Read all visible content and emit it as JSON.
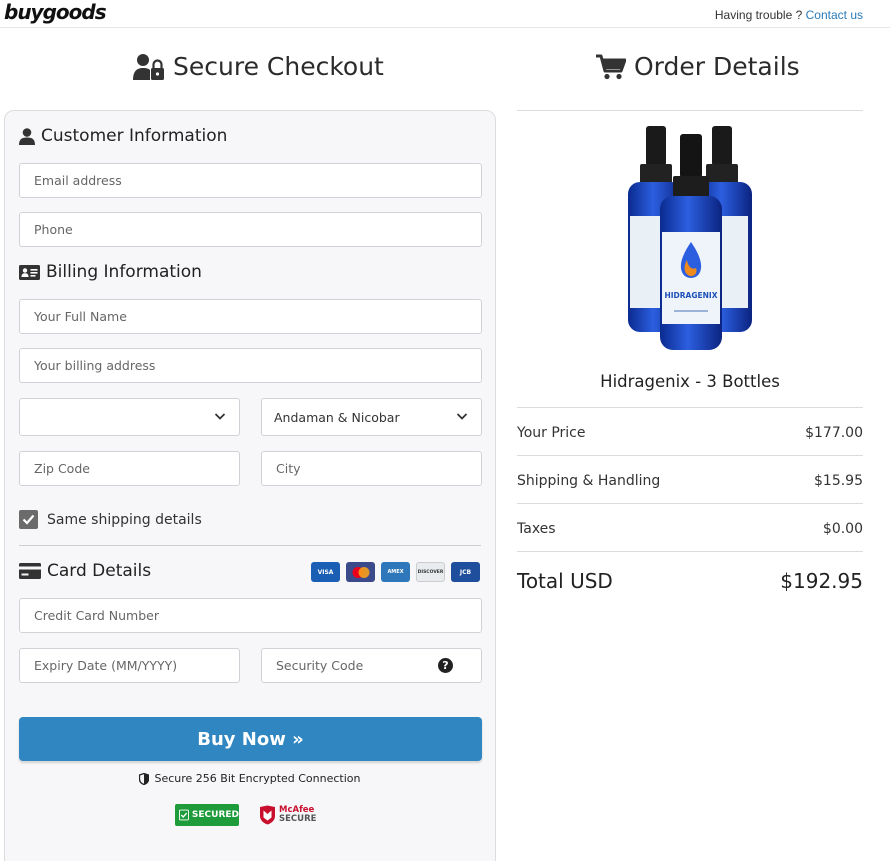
{
  "header": {
    "logo": "buygoods",
    "trouble_text": "Having trouble ?",
    "contact_link": "Contact us"
  },
  "checkout": {
    "title": "Secure Checkout",
    "customer_title": "Customer Information",
    "email_placeholder": "Email address",
    "phone_placeholder": "Phone",
    "billing_title": "Billing Information",
    "name_placeholder": "Your Full Name",
    "address_placeholder": "Your billing address",
    "country_value": "",
    "state_value": "Andaman & Nicobar",
    "zip_placeholder": "Zip Code",
    "city_placeholder": "City",
    "same_shipping_label": "Same shipping details",
    "card_title": "Card Details",
    "card_logos": [
      "VISA",
      "mastercard",
      "AMEX",
      "DISCOVER",
      "JCB"
    ],
    "card_number_placeholder": "Credit Card Number",
    "expiry_placeholder": "Expiry Date (MM/YYYY)",
    "cvv_placeholder": "Security Code",
    "buy_label": "Buy Now »",
    "secure_text": "Secure 256 Bit Encrypted Connection",
    "badge_trustedsite": "SECURED",
    "badge_mcafee_line1": "McAfee",
    "badge_mcafee_line2": "SECURE"
  },
  "order": {
    "title": "Order Details",
    "product_name": "Hidragenix - 3 Bottles",
    "bottle_label": "HIDRAGENIX",
    "rows": [
      {
        "label": "Your Price",
        "value": "$177.00"
      },
      {
        "label": "Shipping & Handling",
        "value": "$15.95"
      },
      {
        "label": "Taxes",
        "value": "$0.00"
      }
    ],
    "total_label": "Total USD",
    "total_value": "$192.95"
  },
  "colors": {
    "accent": "#2f86c1",
    "link": "#2a7ab8",
    "badge_green": "#1e9b3a",
    "mcafee_red": "#c8102e"
  }
}
